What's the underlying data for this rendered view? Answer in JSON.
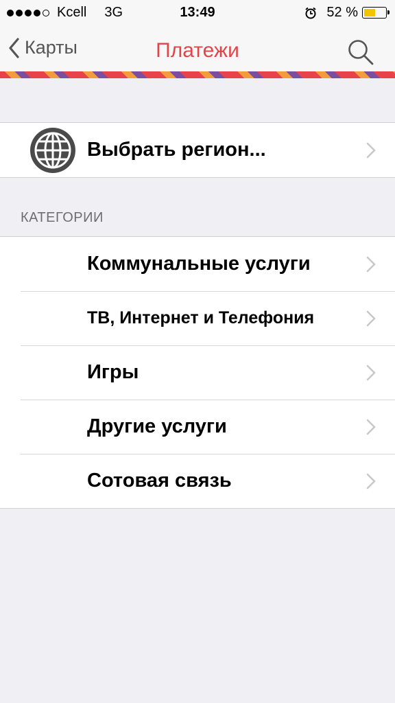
{
  "status_bar": {
    "carrier": "Kcell",
    "network": "3G",
    "time": "13:49",
    "battery_percent": "52 %",
    "battery_level": 0.52
  },
  "nav": {
    "back_label": "Карты",
    "title": "Платежи",
    "accent_color": "#e0454a"
  },
  "region": {
    "label": "Выбрать регион...",
    "icon": "globe-icon"
  },
  "categories": {
    "header": "КАТЕГОРИИ",
    "items": [
      {
        "label": "Коммунальные услуги"
      },
      {
        "label": "ТВ, Интернет и Телефония"
      },
      {
        "label": "Игры"
      },
      {
        "label": "Другие услуги"
      },
      {
        "label": "Сотовая связь"
      }
    ]
  }
}
